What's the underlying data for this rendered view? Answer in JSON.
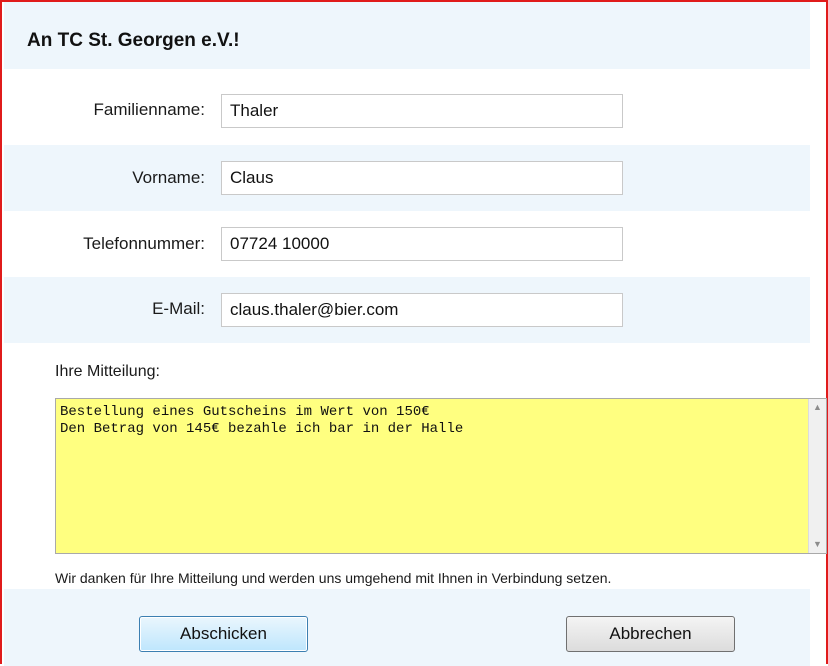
{
  "form": {
    "title": "An TC St. Georgen e.V.!",
    "fields": {
      "lastname": {
        "label": "Familienname:",
        "value": "Thaler"
      },
      "firstname": {
        "label": "Vorname:",
        "value": "Claus"
      },
      "phone": {
        "label": "Telefonnummer:",
        "value": "07724 10000"
      },
      "email": {
        "label": "E-Mail:",
        "value": "claus.thaler@bier.com"
      }
    },
    "message": {
      "label": "Ihre Mitteilung:",
      "value": "Bestellung eines Gutscheins im Wert von 150€\nDen Betrag von 145€ bezahle ich bar in der Halle"
    },
    "thanks_text": "Wir danken für Ihre Mitteilung und werden uns umgehend mit Ihnen in Verbindung setzen.",
    "buttons": {
      "submit": "Abschicken",
      "cancel": "Abbrechen"
    }
  },
  "colors": {
    "frame_border": "#e01b1b",
    "band_light": "#eef6fc",
    "textarea_bg": "#ffff80",
    "primary_button": "#bee6fd"
  },
  "icons": {
    "scroll_up": "scroll-up-arrow",
    "scroll_down": "scroll-down-arrow"
  }
}
